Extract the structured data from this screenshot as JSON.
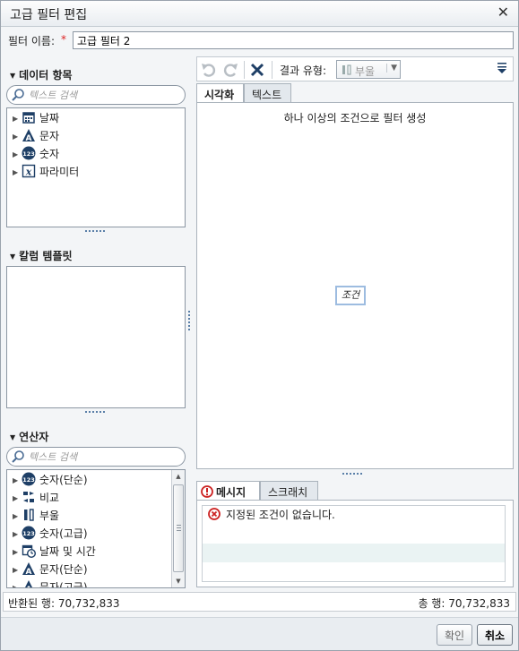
{
  "dialog": {
    "title": "고급 필터 편집",
    "close_symbol": "✕"
  },
  "filter_name": {
    "label": "필터 이름:",
    "required_mark": "*",
    "value": "고급 필터 2"
  },
  "data_items": {
    "header": "데이터 항목",
    "search_placeholder": "텍스트 검색",
    "items": [
      {
        "label": "날짜",
        "icon": "calendar-icon"
      },
      {
        "label": "문자",
        "icon": "character-icon"
      },
      {
        "label": "숫자",
        "icon": "numeric-123-icon"
      },
      {
        "label": "파라미터",
        "icon": "parameter-x-icon"
      }
    ]
  },
  "column_templates": {
    "header": "칼럼 템플릿"
  },
  "operators": {
    "header": "연산자",
    "search_placeholder": "텍스트 검색",
    "items": [
      {
        "label": "숫자(단순)",
        "icon": "numeric-123-icon"
      },
      {
        "label": "비교",
        "icon": "compare-icon"
      },
      {
        "label": "부울",
        "icon": "boolean-icon"
      },
      {
        "label": "숫자(고급)",
        "icon": "numeric-123-icon"
      },
      {
        "label": "날짜 및 시간",
        "icon": "datetime-icon"
      },
      {
        "label": "문자(단순)",
        "icon": "character-icon"
      },
      {
        "label": "문자(고급)",
        "icon": "character-icon"
      }
    ]
  },
  "toolbar": {
    "result_type_label": "결과 유형:",
    "result_type_value": "부울",
    "icons": [
      "undo-icon",
      "redo-icon",
      "delete-icon",
      "boolean-icon",
      "dropdown-arrow-icon",
      "menu-icon"
    ]
  },
  "editor_tabs": [
    "시각화",
    "텍스트"
  ],
  "canvas": {
    "hint": "하나 이상의 조건으로 필터 생성",
    "condition_placeholder": "조건"
  },
  "message_tabs": [
    "메시지",
    "스크래치"
  ],
  "messages": [
    {
      "text": "지정된 조건이 없습니다.",
      "icon": "error-circle-icon"
    }
  ],
  "status": {
    "returned_rows": "반환된 행:  70,732,833",
    "total_rows": "총 행:  70,732,833"
  },
  "buttons": {
    "ok": "확인",
    "cancel": "취소"
  },
  "colors": {
    "accent": "#4a78b0",
    "error": "#cc2222",
    "selection_border": "#9dbce0"
  }
}
